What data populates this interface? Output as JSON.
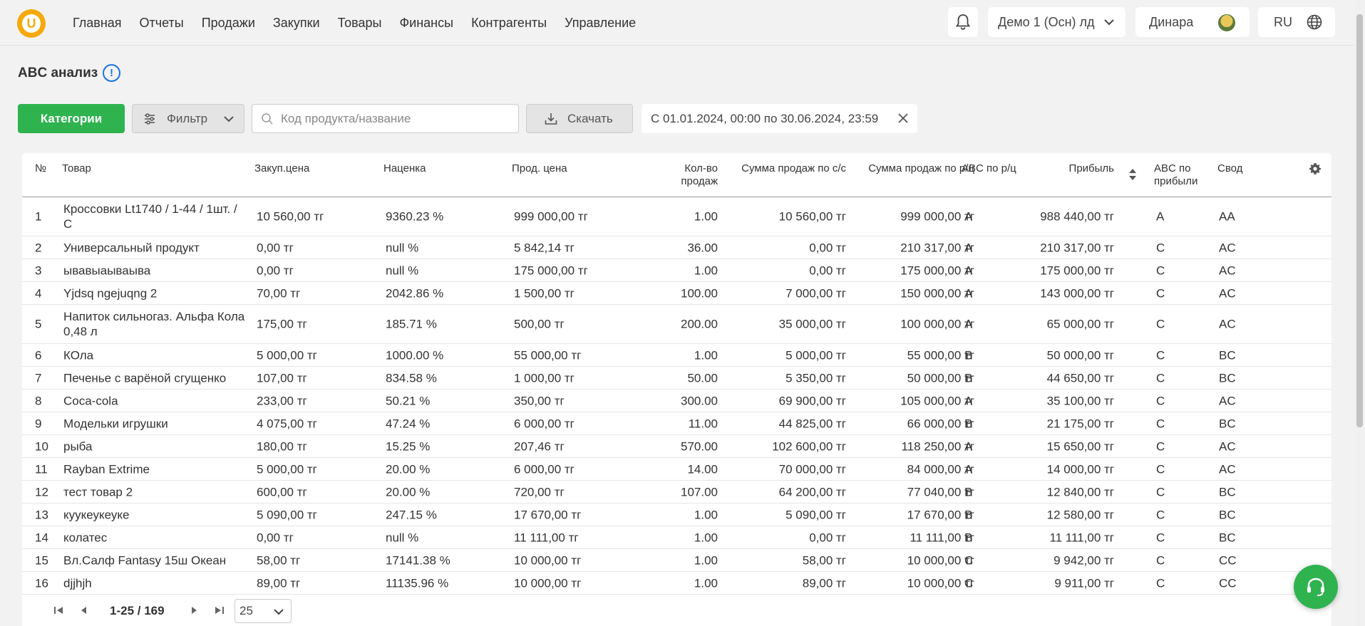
{
  "nav": {
    "logo_letter": "U",
    "items": [
      "Главная",
      "Отчеты",
      "Продажи",
      "Закупки",
      "Товары",
      "Финансы",
      "Контрагенты",
      "Управление"
    ],
    "company": "Демо 1 (Осн) лд",
    "user": "Динара",
    "lang": "RU"
  },
  "page": {
    "title": "ABC анализ",
    "info": "!"
  },
  "toolbar": {
    "categories_label": "Категории",
    "filter_label": "Фильтр",
    "search_placeholder": "Код продукта/название",
    "download_label": "Скачать",
    "date_range": "С 01.01.2024, 00:00 по 30.06.2024, 23:59"
  },
  "table": {
    "headers": {
      "num": "№",
      "product": "Товар",
      "purchase_price": "Закуп.цена",
      "markup": "Наценка",
      "sale_price": "Прод. цена",
      "qty": "Кол-во продаж",
      "sum_cost": "Сумма продаж по с/с",
      "sum_retail": "Сумма продаж по р/ц",
      "abc_retail": "ABC по р/ц",
      "profit": "Прибыль",
      "abc_profit": "ABC по прибыли",
      "summary": "Свод"
    },
    "rows": [
      {
        "num": "1",
        "product": "Кроссовки Lt1740 / 1-44 / 1шт. / C",
        "purchase": "10 560,00 тг",
        "markup": "9360.23 %",
        "sale": "999 000,00 тг",
        "qty": "1.00",
        "sum_cost": "10 560,00 тг",
        "sum_retail": "999 000,00 тг",
        "abc_retail": "A",
        "profit": "988 440,00 тг",
        "abc_profit": "A",
        "summary": "AA"
      },
      {
        "num": "2",
        "product": "Универсальный продукт",
        "purchase": "0,00 тг",
        "markup": "null %",
        "sale": "5 842,14 тг",
        "qty": "36.00",
        "sum_cost": "0,00 тг",
        "sum_retail": "210 317,00 тг",
        "abc_retail": "A",
        "profit": "210 317,00 тг",
        "abc_profit": "C",
        "summary": "AC"
      },
      {
        "num": "3",
        "product": "ывавыаываыва",
        "purchase": "0,00 тг",
        "markup": "null %",
        "sale": "175 000,00 тг",
        "qty": "1.00",
        "sum_cost": "0,00 тг",
        "sum_retail": "175 000,00 тг",
        "abc_retail": "A",
        "profit": "175 000,00 тг",
        "abc_profit": "C",
        "summary": "AC"
      },
      {
        "num": "4",
        "product": "Yjdsq ngejuqng 2",
        "purchase": "70,00 тг",
        "markup": "2042.86 %",
        "sale": "1 500,00 тг",
        "qty": "100.00",
        "sum_cost": "7 000,00 тг",
        "sum_retail": "150 000,00 тг",
        "abc_retail": "A",
        "profit": "143 000,00 тг",
        "abc_profit": "C",
        "summary": "AC"
      },
      {
        "num": "5",
        "product": "Напиток сильногаз. Альфа Кола 0,48 л",
        "purchase": "175,00 тг",
        "markup": "185.71 %",
        "sale": "500,00 тг",
        "qty": "200.00",
        "sum_cost": "35 000,00 тг",
        "sum_retail": "100 000,00 тг",
        "abc_retail": "A",
        "profit": "65 000,00 тг",
        "abc_profit": "C",
        "summary": "AC"
      },
      {
        "num": "6",
        "product": "КОла",
        "purchase": "5 000,00 тг",
        "markup": "1000.00 %",
        "sale": "55 000,00 тг",
        "qty": "1.00",
        "sum_cost": "5 000,00 тг",
        "sum_retail": "55 000,00 тг",
        "abc_retail": "B",
        "profit": "50 000,00 тг",
        "abc_profit": "C",
        "summary": "BC"
      },
      {
        "num": "7",
        "product": "Печенье с варёной сгущенко",
        "purchase": "107,00 тг",
        "markup": "834.58 %",
        "sale": "1 000,00 тг",
        "qty": "50.00",
        "sum_cost": "5 350,00 тг",
        "sum_retail": "50 000,00 тг",
        "abc_retail": "B",
        "profit": "44 650,00 тг",
        "abc_profit": "C",
        "summary": "BC"
      },
      {
        "num": "8",
        "product": "Coca-cola",
        "purchase": "233,00 тг",
        "markup": "50.21 %",
        "sale": "350,00 тг",
        "qty": "300.00",
        "sum_cost": "69 900,00 тг",
        "sum_retail": "105 000,00 тг",
        "abc_retail": "A",
        "profit": "35 100,00 тг",
        "abc_profit": "C",
        "summary": "AC"
      },
      {
        "num": "9",
        "product": "Модельки игрушки",
        "purchase": "4 075,00 тг",
        "markup": "47.24 %",
        "sale": "6 000,00 тг",
        "qty": "11.00",
        "sum_cost": "44 825,00 тг",
        "sum_retail": "66 000,00 тг",
        "abc_retail": "B",
        "profit": "21 175,00 тг",
        "abc_profit": "C",
        "summary": "BC"
      },
      {
        "num": "10",
        "product": "рыба",
        "purchase": "180,00 тг",
        "markup": "15.25 %",
        "sale": "207,46 тг",
        "qty": "570.00",
        "sum_cost": "102 600,00 тг",
        "sum_retail": "118 250,00 тг",
        "abc_retail": "A",
        "profit": "15 650,00 тг",
        "abc_profit": "C",
        "summary": "AC"
      },
      {
        "num": "11",
        "product": "Rayban Extrime",
        "purchase": "5 000,00 тг",
        "markup": "20.00 %",
        "sale": "6 000,00 тг",
        "qty": "14.00",
        "sum_cost": "70 000,00 тг",
        "sum_retail": "84 000,00 тг",
        "abc_retail": "A",
        "profit": "14 000,00 тг",
        "abc_profit": "C",
        "summary": "AC"
      },
      {
        "num": "12",
        "product": "тест товар 2",
        "purchase": "600,00 тг",
        "markup": "20.00 %",
        "sale": "720,00 тг",
        "qty": "107.00",
        "sum_cost": "64 200,00 тг",
        "sum_retail": "77 040,00 тг",
        "abc_retail": "B",
        "profit": "12 840,00 тг",
        "abc_profit": "C",
        "summary": "BC"
      },
      {
        "num": "13",
        "product": "куукеукеуке",
        "purchase": "5 090,00 тг",
        "markup": "247.15 %",
        "sale": "17 670,00 тг",
        "qty": "1.00",
        "sum_cost": "5 090,00 тг",
        "sum_retail": "17 670,00 тг",
        "abc_retail": "B",
        "profit": "12 580,00 тг",
        "abc_profit": "C",
        "summary": "BC"
      },
      {
        "num": "14",
        "product": "колатес",
        "purchase": "0,00 тг",
        "markup": "null %",
        "sale": "11 111,00 тг",
        "qty": "1.00",
        "sum_cost": "0,00 тг",
        "sum_retail": "11 111,00 тг",
        "abc_retail": "B",
        "profit": "11 111,00 тг",
        "abc_profit": "C",
        "summary": "BC"
      },
      {
        "num": "15",
        "product": "Вл.Салф Fantasy 15ш Океан",
        "purchase": "58,00 тг",
        "markup": "17141.38 %",
        "sale": "10 000,00 тг",
        "qty": "1.00",
        "sum_cost": "58,00 тг",
        "sum_retail": "10 000,00 тг",
        "abc_retail": "C",
        "profit": "9 942,00 тг",
        "abc_profit": "C",
        "summary": "CC"
      },
      {
        "num": "16",
        "product": "djjhjh",
        "purchase": "89,00 тг",
        "markup": "11135.96 %",
        "sale": "10 000,00 тг",
        "qty": "1.00",
        "sum_cost": "89,00 тг",
        "sum_retail": "10 000,00 тг",
        "abc_retail": "C",
        "profit": "9 911,00 тг",
        "abc_profit": "C",
        "summary": "CC"
      }
    ]
  },
  "pagination": {
    "range": "1-25 / 169",
    "page_size": "25"
  },
  "colors": {
    "accent_green": "#2fb34f",
    "logo_orange": "#f5a90d",
    "info_blue": "#1a73e8"
  }
}
